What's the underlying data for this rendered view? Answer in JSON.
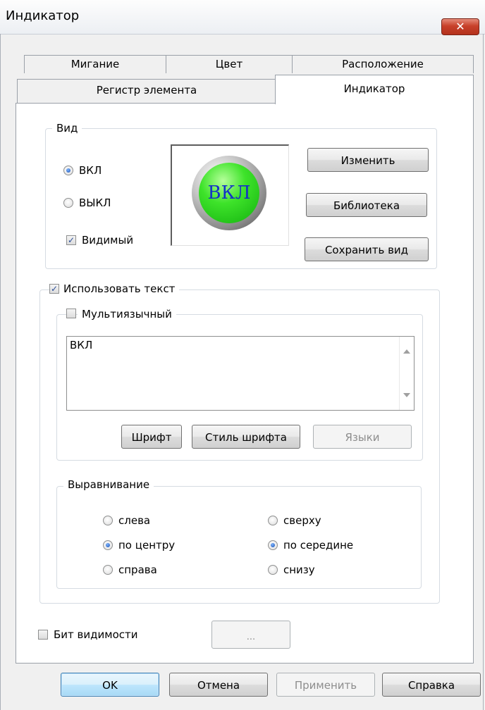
{
  "window": {
    "title": "Индикатор",
    "close_glyph": "✕"
  },
  "tabs": {
    "row1": [
      "Мигание",
      "Цвет",
      "Расположение"
    ],
    "row2": [
      "Регистр элемента",
      "Индикатор"
    ],
    "active": "Индикатор"
  },
  "view": {
    "legend": "Вид",
    "state_on": "ВКЛ",
    "state_off": "ВЫКЛ",
    "selected_state": "ВКЛ",
    "visible_label": "Видимый",
    "visible_checked": true,
    "preview_text": "ВКЛ",
    "preview_color": "#2ee01f",
    "buttons": {
      "change": "Изменить",
      "library": "Библиотека",
      "save": "Сохранить вид"
    }
  },
  "text_section": {
    "use_text_label": "Использовать текст",
    "use_text_checked": true,
    "multilang_label": "Мультиязычный",
    "multilang_checked": false,
    "text_value": "ВКЛ",
    "buttons": {
      "font": "Шрифт",
      "font_style": "Стиль шрифта",
      "languages": "Языки"
    }
  },
  "alignment": {
    "legend": "Выравнивание",
    "horizontal": [
      "слева",
      "по центру",
      "справа"
    ],
    "horizontal_selected": "по центру",
    "vertical": [
      "сверху",
      "по середине",
      "снизу"
    ],
    "vertical_selected": "по середине"
  },
  "visibility_bit": {
    "label": "Бит видимости",
    "checked": false,
    "browse_label": "..."
  },
  "footer": {
    "ok": "OK",
    "cancel": "Отмена",
    "apply": "Применить",
    "help": "Справка"
  },
  "colors": {
    "close_button": "#c8412b",
    "tab_panel": "#ffffff",
    "dialog_bg": "#f0f0f0",
    "lamp_text": "#1330c8"
  }
}
